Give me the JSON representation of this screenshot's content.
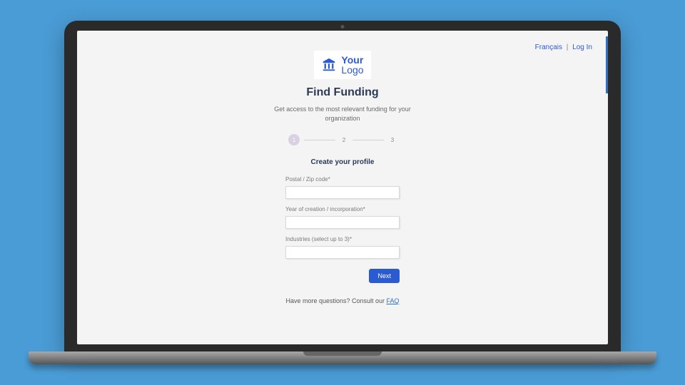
{
  "header": {
    "language_link": "Français",
    "login_link": "Log In"
  },
  "logo": {
    "line1": "Your",
    "line2": "Logo"
  },
  "page": {
    "title": "Find Funding",
    "subtitle": "Get access to the most relevant funding for your organization"
  },
  "stepper": {
    "active": 1,
    "steps": [
      "1",
      "2",
      "3"
    ]
  },
  "form": {
    "section_title": "Create your profile",
    "fields": {
      "postal": {
        "label": "Postal / Zip code*",
        "value": ""
      },
      "year": {
        "label": "Year of creation / incorporation*",
        "value": ""
      },
      "industries": {
        "label": "Industries (select up to 3)*",
        "value": ""
      }
    },
    "next_label": "Next"
  },
  "footer": {
    "faq_prefix": "Have more questions? Consult our ",
    "faq_link": "FAQ"
  }
}
